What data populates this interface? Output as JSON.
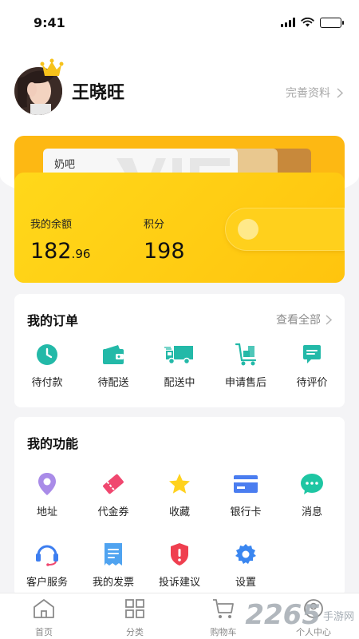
{
  "status_bar": {
    "time": "9:41"
  },
  "profile": {
    "name": "王晓旺",
    "edit_label": "完善资料"
  },
  "wallet": {
    "card_name": "奶吧",
    "balance_label": "我的余额",
    "balance_main": "182",
    "balance_decimal": ".96",
    "points_label": "积分",
    "points_value": "198",
    "colors": {
      "base": "#fdb813",
      "front": "#ffd81a"
    }
  },
  "orders": {
    "title": "我的订单",
    "view_all": "查看全部",
    "items": [
      {
        "label": "待付款",
        "icon": "clock-icon"
      },
      {
        "label": "待配送",
        "icon": "wallet-icon"
      },
      {
        "label": "配送中",
        "icon": "truck-icon"
      },
      {
        "label": "申请售后",
        "icon": "cart-dolly-icon"
      },
      {
        "label": "待评价",
        "icon": "comment-icon"
      }
    ]
  },
  "features": {
    "title": "我的功能",
    "items": [
      {
        "label": "地址",
        "icon": "location-pin-icon"
      },
      {
        "label": "代金券",
        "icon": "coupon-icon"
      },
      {
        "label": "收藏",
        "icon": "star-icon"
      },
      {
        "label": "银行卡",
        "icon": "bank-card-icon"
      },
      {
        "label": "消息",
        "icon": "message-icon"
      },
      {
        "label": "客户服务",
        "icon": "headset-icon"
      },
      {
        "label": "我的发票",
        "icon": "invoice-icon"
      },
      {
        "label": "投诉建议",
        "icon": "shield-alert-icon"
      },
      {
        "label": "设置",
        "icon": "gear-icon"
      }
    ]
  },
  "tab_bar": {
    "items": [
      {
        "label": "首页",
        "icon": "home-icon"
      },
      {
        "label": "分类",
        "icon": "grid-icon"
      },
      {
        "label": "购物车",
        "icon": "cart-icon"
      },
      {
        "label": "个人中心",
        "icon": "user-icon"
      }
    ]
  },
  "watermark": {
    "number": "2265",
    "text": "手游网"
  },
  "accent_colors": {
    "teal": "#23b9a8",
    "yellow": "#ffd21f"
  }
}
